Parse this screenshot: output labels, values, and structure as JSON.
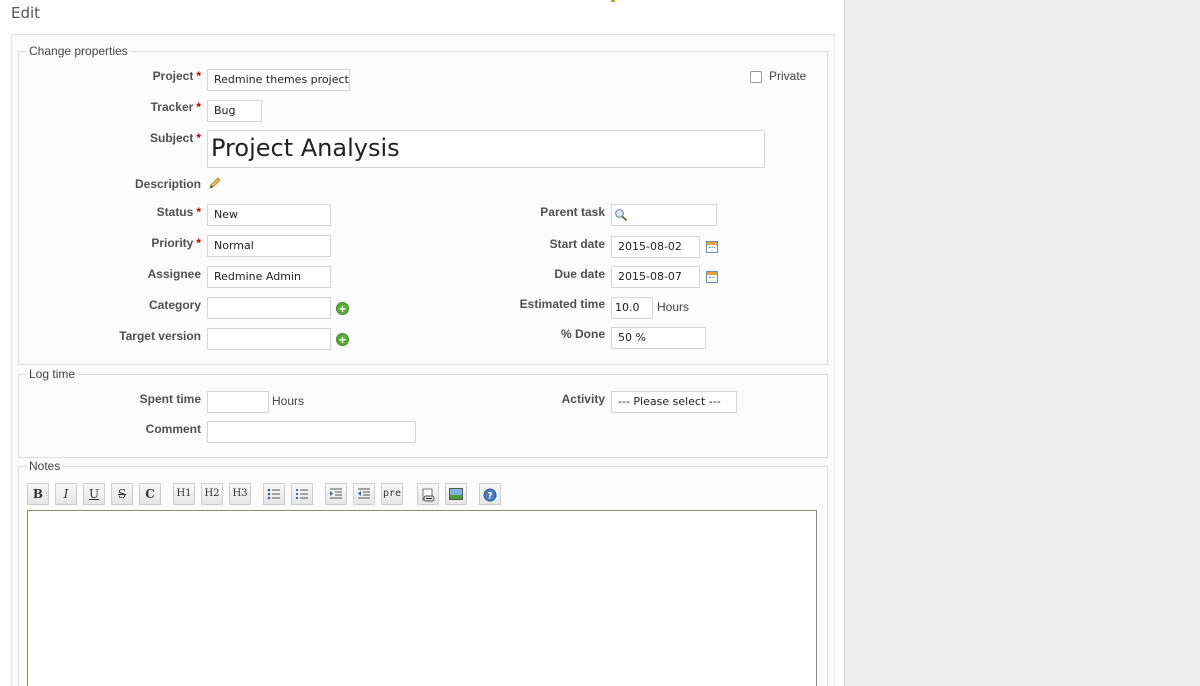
{
  "page": {
    "title": "Edit"
  },
  "properties": {
    "legend": "Change properties",
    "project": {
      "label": "Project",
      "value": "Redmine themes project"
    },
    "private_label": "Private",
    "tracker": {
      "label": "Tracker",
      "value": "Bug"
    },
    "subject": {
      "label": "Subject",
      "value": "Project Analysis"
    },
    "description": {
      "label": "Description"
    },
    "status": {
      "label": "Status",
      "value": "New"
    },
    "priority": {
      "label": "Priority",
      "value": "Normal"
    },
    "assignee": {
      "label": "Assignee",
      "value": "Redmine Admin"
    },
    "category": {
      "label": "Category",
      "value": ""
    },
    "target_version": {
      "label": "Target version",
      "value": ""
    },
    "parent_task": {
      "label": "Parent task",
      "value": ""
    },
    "start_date": {
      "label": "Start date",
      "value": "2015-08-02"
    },
    "due_date": {
      "label": "Due date",
      "value": "2015-08-07"
    },
    "estimated_time": {
      "label": "Estimated time",
      "value": "10.0",
      "unit": "Hours"
    },
    "done": {
      "label": "% Done",
      "value": "50 %"
    },
    "required_marker": "*"
  },
  "log_time": {
    "legend": "Log time",
    "spent_time": {
      "label": "Spent time",
      "value": "",
      "unit": "Hours"
    },
    "activity": {
      "label": "Activity",
      "value": "--- Please select ---"
    },
    "comment": {
      "label": "Comment",
      "value": ""
    }
  },
  "notes": {
    "legend": "Notes",
    "toolbar": {
      "bold": "B",
      "italic": "I",
      "underline": "U",
      "strike": "S",
      "code": "C",
      "h1": "H1",
      "h2": "H2",
      "h3": "H3",
      "pre": "pre"
    },
    "content": ""
  },
  "colors": {
    "required": "#bb0000",
    "plus_icon": "#5cad3b",
    "right_pane_bg": "#eeeeee"
  }
}
